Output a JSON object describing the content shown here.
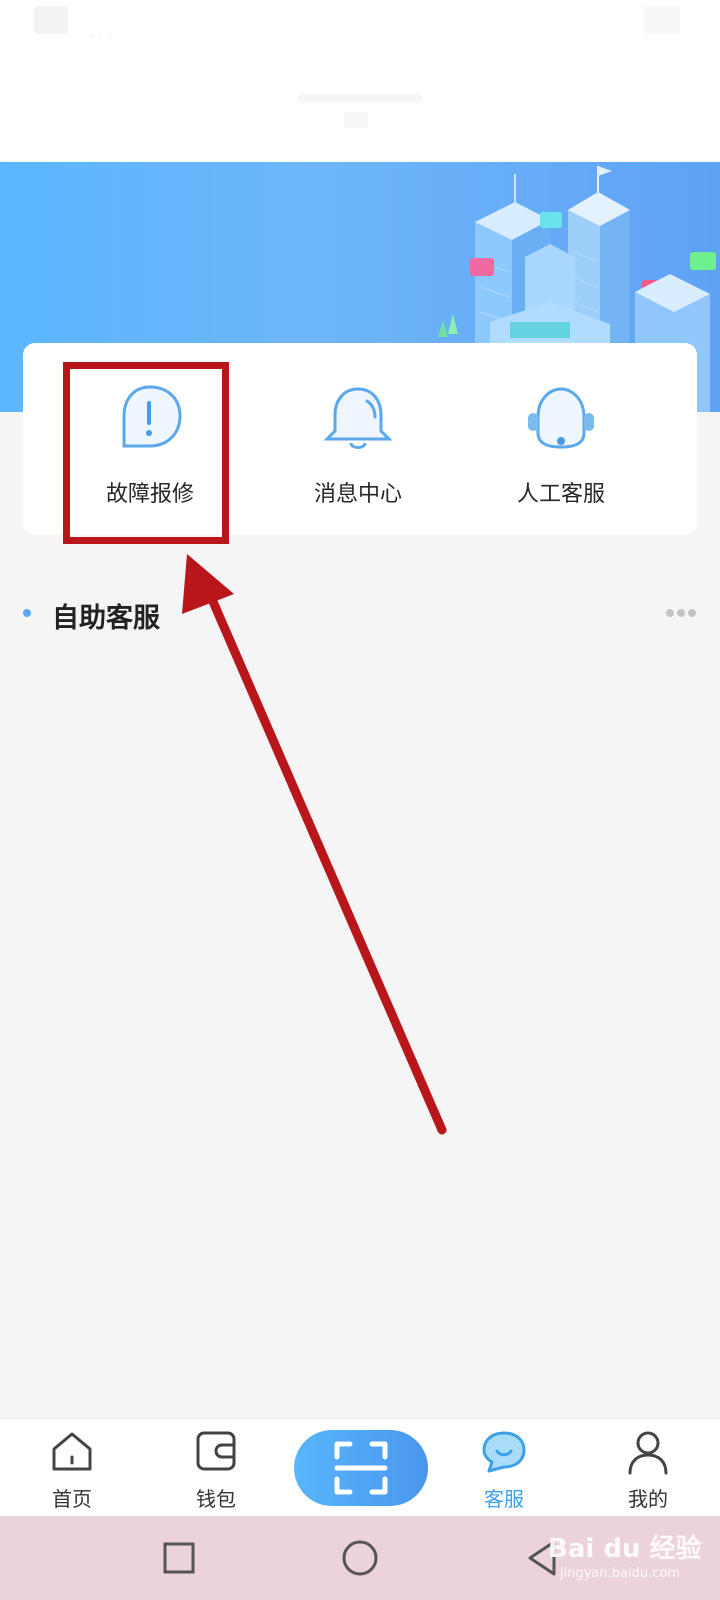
{
  "service_entries": [
    {
      "label": "故障报修",
      "icon": "exclamation-bubble-icon"
    },
    {
      "label": "消息中心",
      "icon": "bell-icon"
    },
    {
      "label": "人工客服",
      "icon": "headset-icon"
    }
  ],
  "section": {
    "title": "自助客服",
    "more_icon": "more-dots-icon"
  },
  "tabbar": {
    "tabs": [
      {
        "label": "首页",
        "icon": "home-icon"
      },
      {
        "label": "钱包",
        "icon": "wallet-icon"
      },
      {
        "label": "客服",
        "icon": "chat-bubble-icon",
        "active": true
      },
      {
        "label": "我的",
        "icon": "person-icon"
      }
    ],
    "scan_icon": "scan-icon"
  },
  "colors": {
    "accent": "#3da0e8",
    "highlight": "#b8161b",
    "banner": "#5ea7f2"
  },
  "watermark": {
    "brand": "Bai du 经验",
    "url": "jingyan.baidu.com"
  }
}
